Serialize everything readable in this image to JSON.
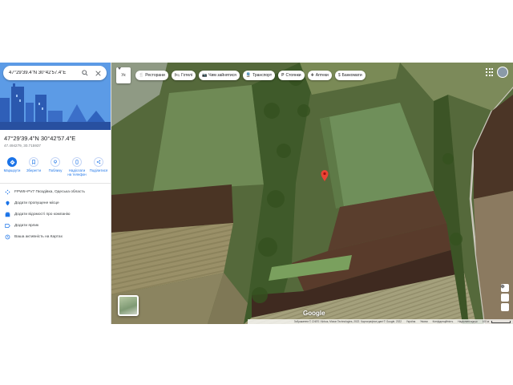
{
  "search": {
    "value": "47°29'39.4\"N 30°42'57.4\"E"
  },
  "place": {
    "title": "47°29'39.4\"N 30°42'57.4\"E",
    "coords": "47.494279, 30.715937"
  },
  "actions": [
    {
      "label": "Маршрути",
      "icon": "directions-icon"
    },
    {
      "label": "Зберегти",
      "icon": "bookmark-icon"
    },
    {
      "label": "Поблизу",
      "icon": "nearby-icon"
    },
    {
      "label": "Надіслати на телефон",
      "icon": "phone-icon"
    },
    {
      "label": "Поділитися",
      "icon": "share-icon"
    }
  ],
  "info_rows": [
    {
      "text": "FPW6+PV7 Гвоздівка, Одеська область",
      "icon": "plus-code-icon"
    },
    {
      "text": "Додати пропущене місце",
      "icon": "add-place-icon"
    },
    {
      "text": "Додати відомості про компанію",
      "icon": "business-icon"
    },
    {
      "text": "Додати ярлик",
      "icon": "label-icon"
    },
    {
      "text": "Ваша активність на Картах",
      "icon": "history-icon"
    }
  ],
  "map": {
    "lang_select": "Ук",
    "chips": [
      {
        "label": "Ресторани",
        "icon": "restaurant-icon"
      },
      {
        "label": "Готелі",
        "icon": "hotel-icon"
      },
      {
        "label": "Чим зайнятися",
        "icon": "camera-icon"
      },
      {
        "label": "Транспорт",
        "icon": "transit-icon"
      },
      {
        "label": "Стоянки",
        "icon": "parking-icon"
      },
      {
        "label": "Аптеки",
        "icon": "pharmacy-icon"
      },
      {
        "label": "Банкомати",
        "icon": "atm-icon"
      }
    ],
    "logo": "Google",
    "attribution": "Зображення © CNES / Airbus, Maxar Technologies, 2022. Картографічні дані © Google, 2022",
    "links": [
      "Україна",
      "Умови",
      "Конфіденційність",
      "Надіслати відгук"
    ],
    "scale_label": "100 м",
    "pin_color": "#ea4335"
  },
  "colors": {
    "accent": "#1a73e8"
  }
}
